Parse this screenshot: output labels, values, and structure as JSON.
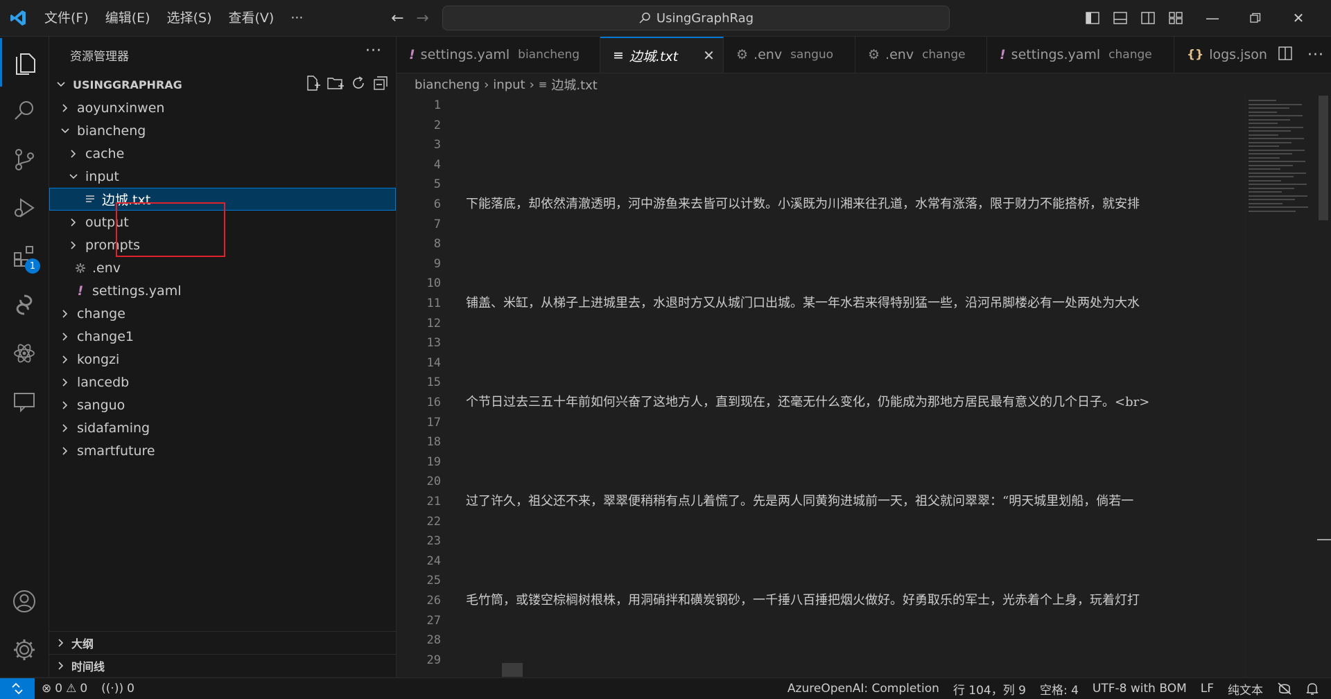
{
  "titlebar": {
    "menu": [
      "文件(F)",
      "编辑(E)",
      "选择(S)",
      "查看(V)",
      "···"
    ],
    "search_text": "UsingGraphRag"
  },
  "activity": {
    "extensions_badge": "1"
  },
  "sidebar": {
    "title": "资源管理器",
    "more": "···",
    "root": "USINGGRAPHRAG",
    "tree": [
      {
        "label": "aoyunxinwen",
        "kind": "folder",
        "expanded": false
      },
      {
        "label": "biancheng",
        "kind": "folder",
        "expanded": true
      },
      {
        "label": "cache",
        "kind": "folder",
        "expanded": false
      },
      {
        "label": "input",
        "kind": "folder",
        "expanded": true
      },
      {
        "label": "边城.txt",
        "kind": "text-file",
        "selected": true
      },
      {
        "label": "output",
        "kind": "folder",
        "expanded": false
      },
      {
        "label": "prompts",
        "kind": "folder",
        "expanded": false
      },
      {
        "label": ".env",
        "kind": "settings-file"
      },
      {
        "label": "settings.yaml",
        "kind": "yaml-file"
      },
      {
        "label": "change",
        "kind": "folder",
        "expanded": false
      },
      {
        "label": "change1",
        "kind": "folder",
        "expanded": false
      },
      {
        "label": "kongzi",
        "kind": "folder",
        "expanded": false
      },
      {
        "label": "lancedb",
        "kind": "folder",
        "expanded": false
      },
      {
        "label": "sanguo",
        "kind": "folder",
        "expanded": false
      },
      {
        "label": "sidafaming",
        "kind": "folder",
        "expanded": false
      },
      {
        "label": "smartfuture",
        "kind": "folder",
        "expanded": false
      }
    ],
    "outline": "大纲",
    "timeline": "时间线"
  },
  "tabs": [
    {
      "icon": "!",
      "name": "settings.yaml",
      "desc": "biancheng",
      "active": false
    },
    {
      "icon": "≡",
      "name": "边城.txt",
      "desc": "",
      "active": true
    },
    {
      "icon": "⚙",
      "name": ".env",
      "desc": "sanguo",
      "active": false
    },
    {
      "icon": "⚙",
      "name": ".env",
      "desc": "change",
      "active": false
    },
    {
      "icon": "!",
      "name": "settings.yaml",
      "desc": "change",
      "active": false
    },
    {
      "icon": "{}",
      "name": "logs.json",
      "desc": "",
      "active": false
    }
  ],
  "breadcrumb": [
    "biancheng",
    "input",
    "边城.txt"
  ],
  "editor": {
    "lines": [
      {
        "n": "1",
        "text": ""
      },
      {
        "n": "2",
        "text": ""
      },
      {
        "n": "3",
        "text": ""
      },
      {
        "n": "4",
        "text": ""
      },
      {
        "n": "5",
        "text": ""
      },
      {
        "n": "6",
        "text": "下能落底，却依然清澈透明，河中游鱼来去皆可以计数。小溪既为川湘来往孔道，水常有涨落，限于财力不能搭桥，就安排"
      },
      {
        "n": "7",
        "text": ""
      },
      {
        "n": "8",
        "text": ""
      },
      {
        "n": "9",
        "text": ""
      },
      {
        "n": "10",
        "text": ""
      },
      {
        "n": "11",
        "text": "铺盖、米缸，从梯子上进城里去，水退时方又从城门口出城。某一年水若来得特别猛一些，沿河吊脚楼必有一处两处为大水"
      },
      {
        "n": "12",
        "text": ""
      },
      {
        "n": "13",
        "text": ""
      },
      {
        "n": "14",
        "text": ""
      },
      {
        "n": "15",
        "text": ""
      },
      {
        "n": "16",
        "text": "个节日过去三五十年前如何兴奋了这地方人，直到现在，还毫无什么变化，仍能成为那地方居民最有意义的几个日子。<br>"
      },
      {
        "n": "17",
        "text": ""
      },
      {
        "n": "18",
        "text": ""
      },
      {
        "n": "19",
        "text": ""
      },
      {
        "n": "20",
        "text": ""
      },
      {
        "n": "21",
        "text": "过了许久，祖父还不来，翠翠便稍稍有点儿着慌了。先是两人同黄狗进城前一天，祖父就问翠翠：“明天城里划船，倘若一"
      },
      {
        "n": "22",
        "text": ""
      },
      {
        "n": "23",
        "text": ""
      },
      {
        "n": "24",
        "text": ""
      },
      {
        "n": "25",
        "text": ""
      },
      {
        "n": "26",
        "text": "毛竹筒，或镂空棕榈树根株，用洞硝拌和磺炭钢砂，一千捶八百捶把烟火做好。好勇取乐的军士，光赤着个上身，玩着灯打"
      },
      {
        "n": "27",
        "text": ""
      },
      {
        "n": "28",
        "text": ""
      },
      {
        "n": "29",
        "text": ""
      }
    ]
  },
  "statusbar": {
    "errors": "0",
    "warnings": "0",
    "ports": "0",
    "completion": "AzureOpenAI: Completion",
    "cursor": "行 104，列 9",
    "spaces": "空格: 4",
    "encoding": "UTF-8 with BOM",
    "eol": "LF",
    "language": "纯文本"
  },
  "colors": {
    "accent": "#0078d4",
    "selection": "#04395e",
    "highlight_box": "#e0232b",
    "yaml_icon": "#c586c0",
    "json_icon": "#e2c08d"
  }
}
